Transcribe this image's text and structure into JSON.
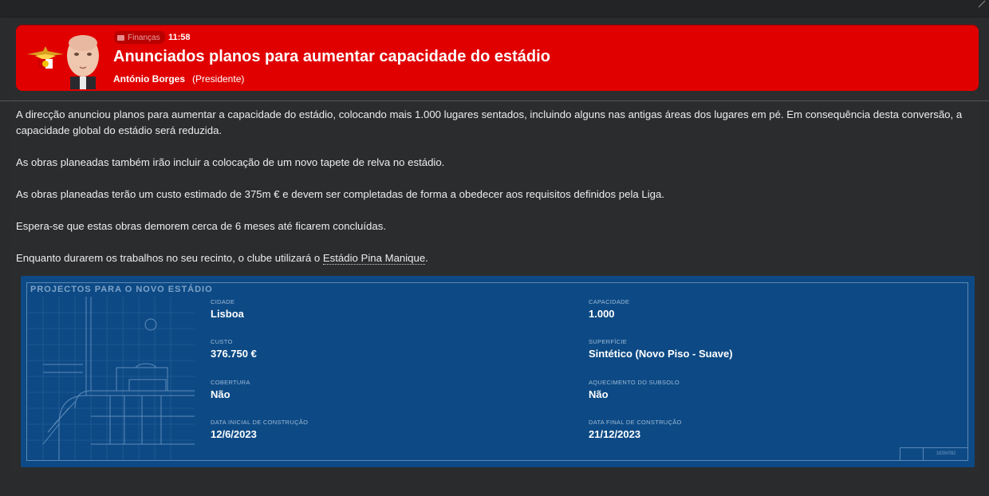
{
  "header": {
    "category": "Finanças",
    "time": "11:58",
    "title": "Anunciados planos para aumentar capacidade do estádio",
    "author": "António Borges",
    "role": "(Presidente)"
  },
  "body": {
    "p1": "A direcção anunciou planos para aumentar a capacidade do estádio, colocando mais 1.000 lugares sentados, incluindo alguns nas antigas áreas dos lugares em pé. Em consequência desta conversão, a capacidade global do estádio será reduzida.",
    "p2": "As obras planeadas também irão incluir a colocação de um novo tapete de relva no estádio.",
    "p3": "As obras planeadas terão um custo estimado de 375m € e devem ser completadas de forma a obedecer aos requisitos definidos pela Liga.",
    "p4": "Espera-se que estas obras demorem cerca de 6 meses até ficarem concluídas.",
    "p5_before": "Enquanto durarem os trabalhos no seu recinto, o clube utilizará o ",
    "p5_link": "Estádio Pina Manique",
    "p5_after": "."
  },
  "project": {
    "title": "PROJECTOS PARA O NOVO ESTÁDIO",
    "city_label": "CIDADE",
    "city": "Lisboa",
    "capacity_label": "CAPACIDADE",
    "capacity": "1.000",
    "cost_label": "CUSTO",
    "cost": "376.750 €",
    "surface_label": "SUPERFÍCIE",
    "surface": "Sintético (Novo Piso - Suave)",
    "cover_label": "COBERTURA",
    "cover": "Não",
    "heating_label": "AQUECIMENTO DO SUBSOLO",
    "heating": "Não",
    "start_label": "DATA INICIAL DE CONSTRUÇÃO",
    "start": "12/6/2023",
    "end_label": "DATA FINAL DE CONSTRUÇÃO",
    "end": "21/12/2023",
    "stamp": "1836/092"
  },
  "colors": {
    "header_red": "#e00000",
    "blueprint_blue": "#0d4a85",
    "background": "#2a2b2d"
  }
}
